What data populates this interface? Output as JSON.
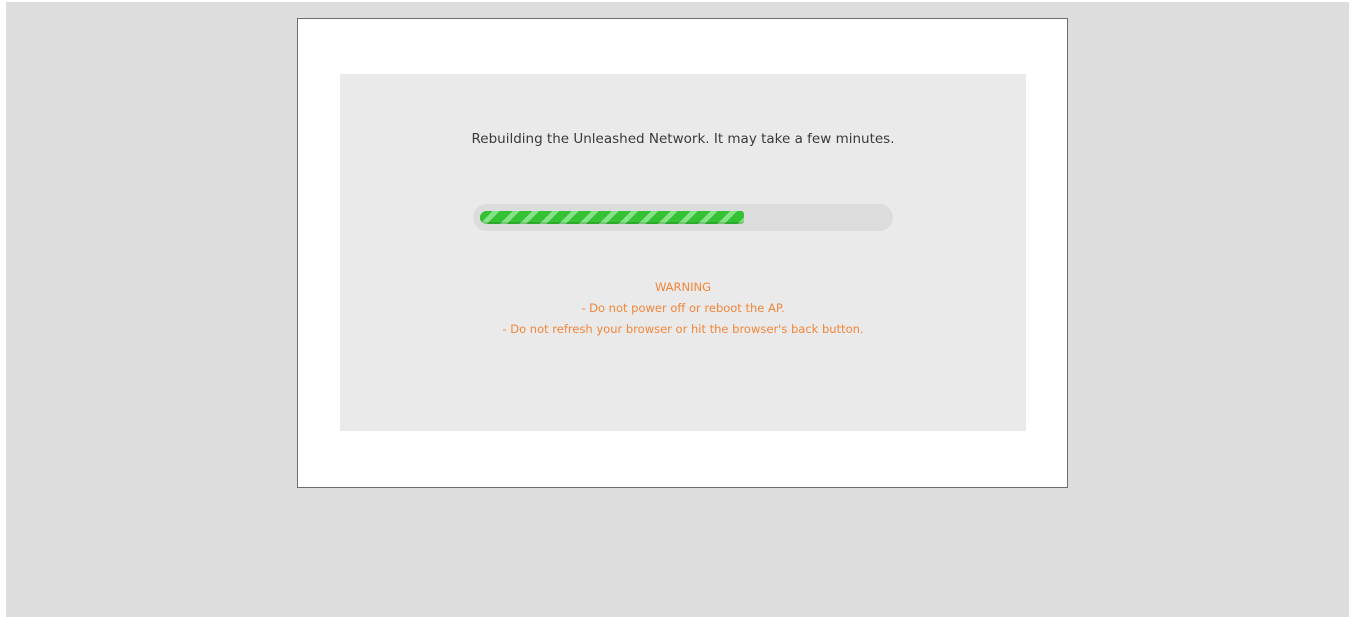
{
  "dialog": {
    "message": "Rebuilding the Unleashed Network. It may take a few minutes.",
    "progress": {
      "percent": 65,
      "fill_color": "#34c234",
      "stripe_color": "#86e286",
      "track_color": "#dcdcdc"
    },
    "warning": {
      "title": "WARNING",
      "lines": [
        "- Do not power off or reboot the AP.",
        "- Do not refresh your browser or hit the browser's back button."
      ],
      "color": "#f2863a"
    }
  }
}
